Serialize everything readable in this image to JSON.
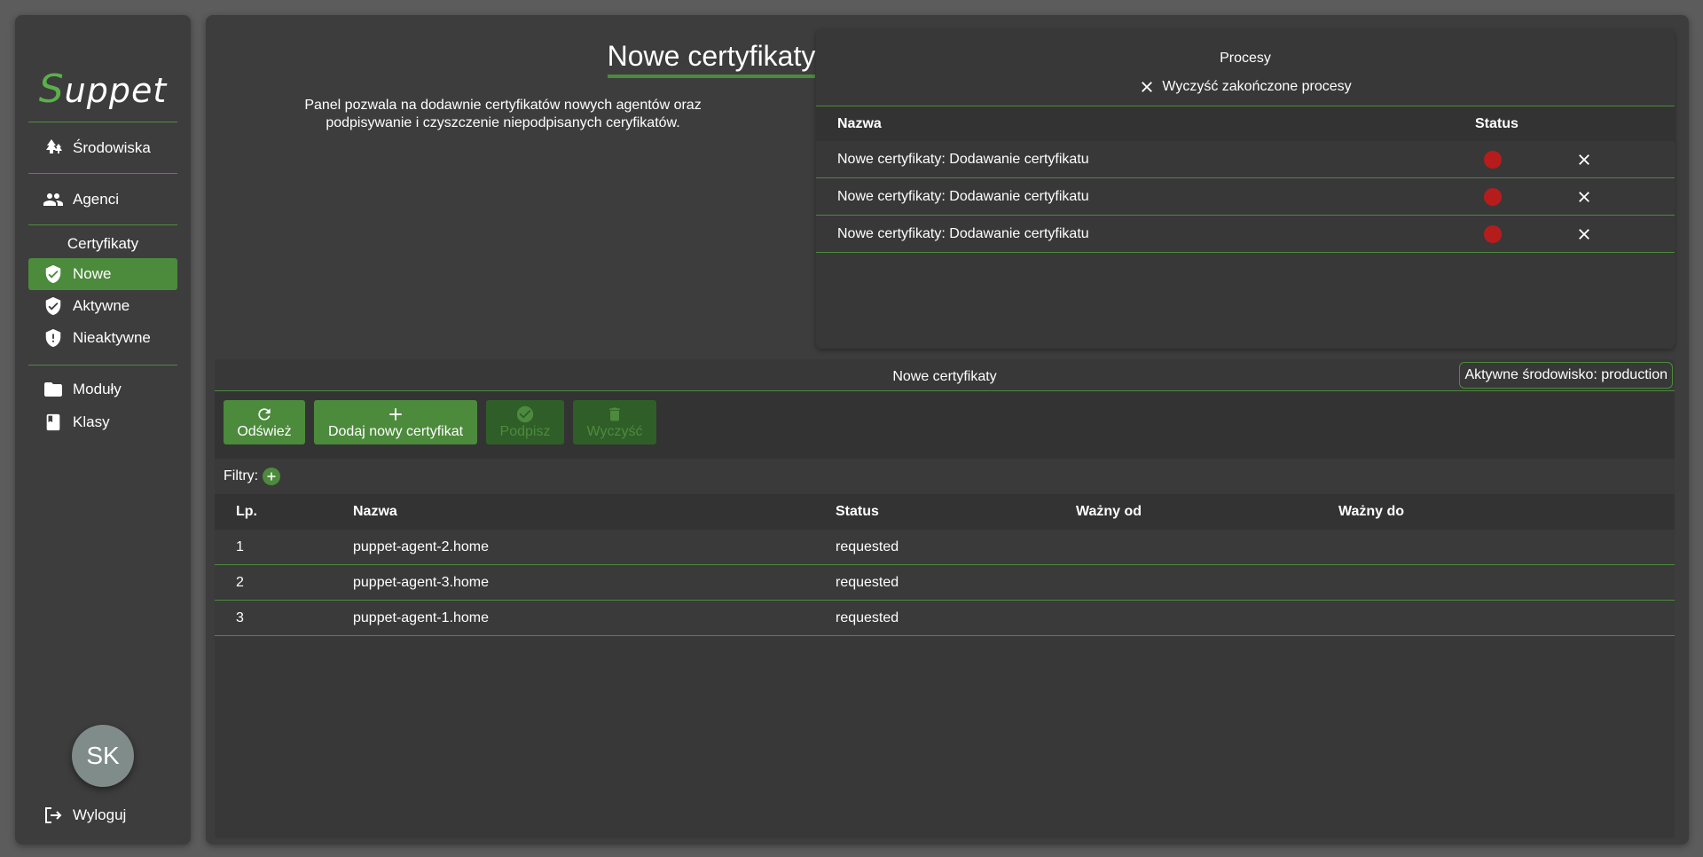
{
  "app": {
    "logo_first": "S",
    "logo_rest": "uppet"
  },
  "sidebar": {
    "environments": "Środowiska",
    "agents": "Agenci",
    "certificates_header": "Certyfikaty",
    "cert_items": [
      "Nowe",
      "Aktywne",
      "Nieaktywne"
    ],
    "modules": "Moduły",
    "classes": "Klasy",
    "avatar": "SK",
    "logout": "Wyloguj"
  },
  "page": {
    "title": "Nowe certyfikaty",
    "description": "Panel pozwala na dodawnie certyfikatów nowych agentów oraz podpisywanie i czyszczenie niepodpisanych ceryfikatów."
  },
  "processes": {
    "title": "Procesy",
    "clear_label": "Wyczyść zakończone procesy",
    "columns": [
      "Nazwa",
      "Status"
    ],
    "rows": [
      {
        "name": "Nowe certyfikaty: Dodawanie certyfikatu",
        "status": "error"
      },
      {
        "name": "Nowe certyfikaty: Dodawanie certyfikatu",
        "status": "error"
      },
      {
        "name": "Nowe certyfikaty: Dodawanie certyfikatu",
        "status": "error"
      }
    ]
  },
  "certs": {
    "title": "Nowe certyfikaty",
    "env_badge": "Aktywne środowisko: production",
    "toolbar": {
      "refresh": "Odśwież",
      "add": "Dodaj nowy certyfikat",
      "sign": "Podpisz",
      "clean": "Wyczyść"
    },
    "filters_label": "Filtry:",
    "columns": [
      "Lp.",
      "Nazwa",
      "Status",
      "Ważny od",
      "Ważny do"
    ],
    "rows": [
      {
        "lp": "1",
        "name": "puppet-agent-2.home",
        "status": "requested",
        "from": "",
        "to": ""
      },
      {
        "lp": "2",
        "name": "puppet-agent-3.home",
        "status": "requested",
        "from": "",
        "to": ""
      },
      {
        "lp": "3",
        "name": "puppet-agent-1.home",
        "status": "requested",
        "from": "",
        "to": ""
      }
    ]
  },
  "colors": {
    "accent": "#4c8a3c",
    "background": "#5c5c5c",
    "panel": "#3d3d3d",
    "error": "#b71c1c"
  }
}
